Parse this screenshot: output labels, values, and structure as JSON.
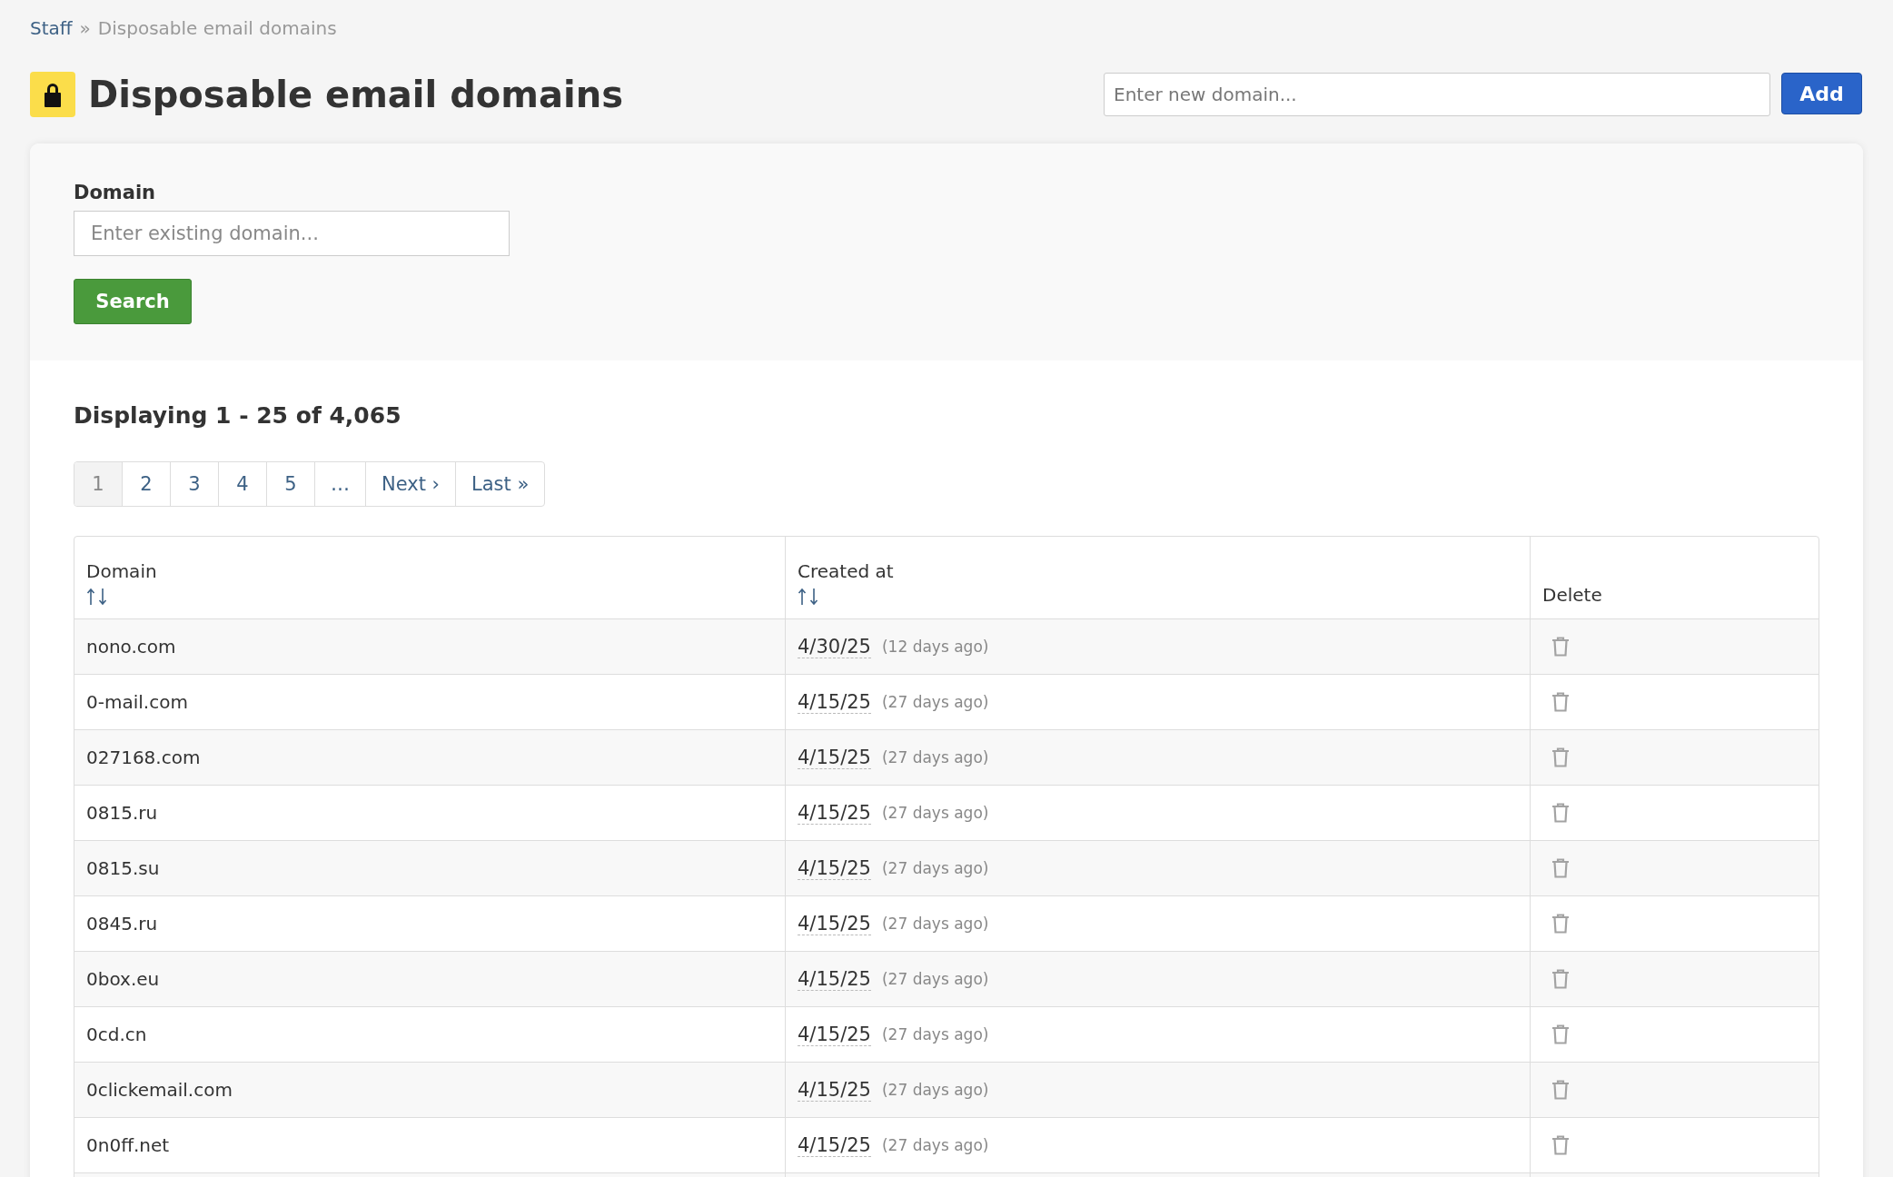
{
  "breadcrumb": {
    "link": "Staff",
    "separator": "»",
    "current": "Disposable email domains"
  },
  "title": "Disposable email domains",
  "add_form": {
    "placeholder": "Enter new domain...",
    "button": "Add"
  },
  "filter": {
    "label": "Domain",
    "placeholder": "Enter existing domain...",
    "button": "Search"
  },
  "summary": "Displaying 1 - 25 of 4,065",
  "pagination": [
    {
      "label": "1",
      "selected": true
    },
    {
      "label": "2",
      "selected": false
    },
    {
      "label": "3",
      "selected": false
    },
    {
      "label": "4",
      "selected": false
    },
    {
      "label": "5",
      "selected": false
    },
    {
      "label": "…",
      "selected": false
    },
    {
      "label": "Next ›",
      "selected": false
    },
    {
      "label": "Last »",
      "selected": false
    }
  ],
  "table": {
    "columns": [
      {
        "label": "Domain",
        "sortable": true
      },
      {
        "label": "Created at",
        "sortable": true
      },
      {
        "label": "Delete",
        "sortable": false
      }
    ],
    "rows": [
      {
        "domain": "nono.com",
        "date": "4/30/25",
        "ago": "(12 days ago)"
      },
      {
        "domain": "0-mail.com",
        "date": "4/15/25",
        "ago": "(27 days ago)"
      },
      {
        "domain": "027168.com",
        "date": "4/15/25",
        "ago": "(27 days ago)"
      },
      {
        "domain": "0815.ru",
        "date": "4/15/25",
        "ago": "(27 days ago)"
      },
      {
        "domain": "0815.su",
        "date": "4/15/25",
        "ago": "(27 days ago)"
      },
      {
        "domain": "0845.ru",
        "date": "4/15/25",
        "ago": "(27 days ago)"
      },
      {
        "domain": "0box.eu",
        "date": "4/15/25",
        "ago": "(27 days ago)"
      },
      {
        "domain": "0cd.cn",
        "date": "4/15/25",
        "ago": "(27 days ago)"
      },
      {
        "domain": "0clickemail.com",
        "date": "4/15/25",
        "ago": "(27 days ago)"
      },
      {
        "domain": "0n0ff.net",
        "date": "4/15/25",
        "ago": "(27 days ago)"
      }
    ]
  }
}
